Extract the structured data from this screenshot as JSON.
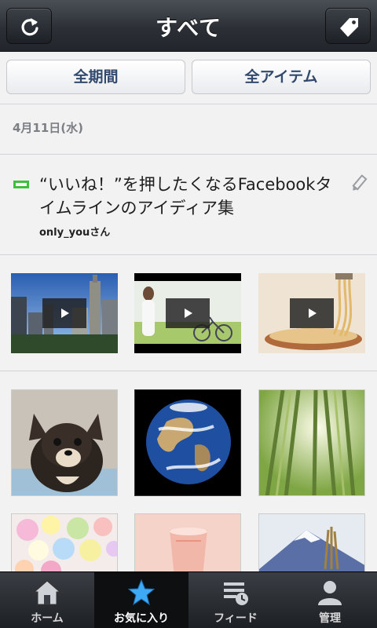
{
  "header": {
    "title": "すべて",
    "left_icon": "refresh-icon",
    "right_icon": "tag-icon"
  },
  "filters": {
    "period": "全期間",
    "items": "全アイテム"
  },
  "date": "4月11日(水)",
  "post": {
    "title": "“いいね！”を押したくなるFacebookタイムラインのアイディア集",
    "author": "only_youさん"
  },
  "tabs": [
    {
      "label": "ホーム",
      "icon": "home-icon"
    },
    {
      "label": "お気に入り",
      "icon": "star-icon"
    },
    {
      "label": "フィード",
      "icon": "feed-icon"
    },
    {
      "label": "管理",
      "icon": "person-icon"
    }
  ],
  "colors": {
    "accent_green": "#3ec03a",
    "active_star": "#3ea9f5"
  }
}
